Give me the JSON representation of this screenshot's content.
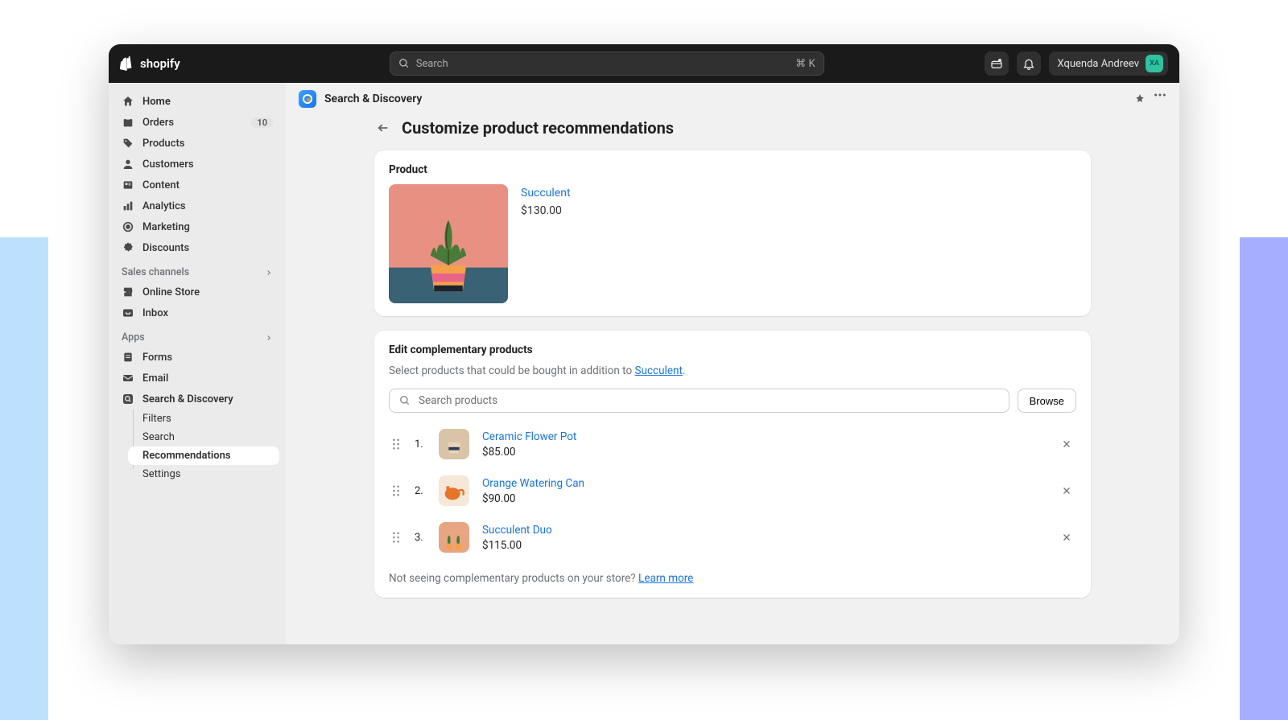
{
  "brand": "shopify",
  "search": {
    "placeholder": "Search",
    "shortcut": "⌘ K"
  },
  "user": {
    "name": "Xquenda Andreev",
    "initials": "XA"
  },
  "sidebar": {
    "main": [
      {
        "label": "Home"
      },
      {
        "label": "Orders",
        "badge": "10"
      },
      {
        "label": "Products"
      },
      {
        "label": "Customers"
      },
      {
        "label": "Content"
      },
      {
        "label": "Analytics"
      },
      {
        "label": "Marketing"
      },
      {
        "label": "Discounts"
      }
    ],
    "salesHeader": "Sales channels",
    "sales": [
      {
        "label": "Online Store"
      },
      {
        "label": "Inbox"
      }
    ],
    "appsHeader": "Apps",
    "apps": [
      {
        "label": "Forms"
      },
      {
        "label": "Email"
      },
      {
        "label": "Search & Discovery"
      }
    ],
    "sdSub": [
      {
        "label": "Filters"
      },
      {
        "label": "Search"
      },
      {
        "label": "Recommendations"
      },
      {
        "label": "Settings"
      }
    ]
  },
  "appBar": {
    "title": "Search & Discovery"
  },
  "page": {
    "title": "Customize product recommendations"
  },
  "productCard": {
    "heading": "Product",
    "name": "Succulent",
    "price": "$130.00"
  },
  "compCard": {
    "heading": "Edit complementary products",
    "helperPrefix": "Select products that could be bought in addition to ",
    "helperLink": "Succulent",
    "helperSuffix": ".",
    "searchPlaceholder": "Search products",
    "browse": "Browse",
    "items": [
      {
        "ord": "1.",
        "name": "Ceramic Flower Pot",
        "price": "$85.00"
      },
      {
        "ord": "2.",
        "name": "Orange Watering Can",
        "price": "$90.00"
      },
      {
        "ord": "3.",
        "name": "Succulent Duo",
        "price": "$115.00"
      }
    ],
    "footerPrefix": "Not seeing complementary products on your store? ",
    "footerLink": "Learn more"
  }
}
